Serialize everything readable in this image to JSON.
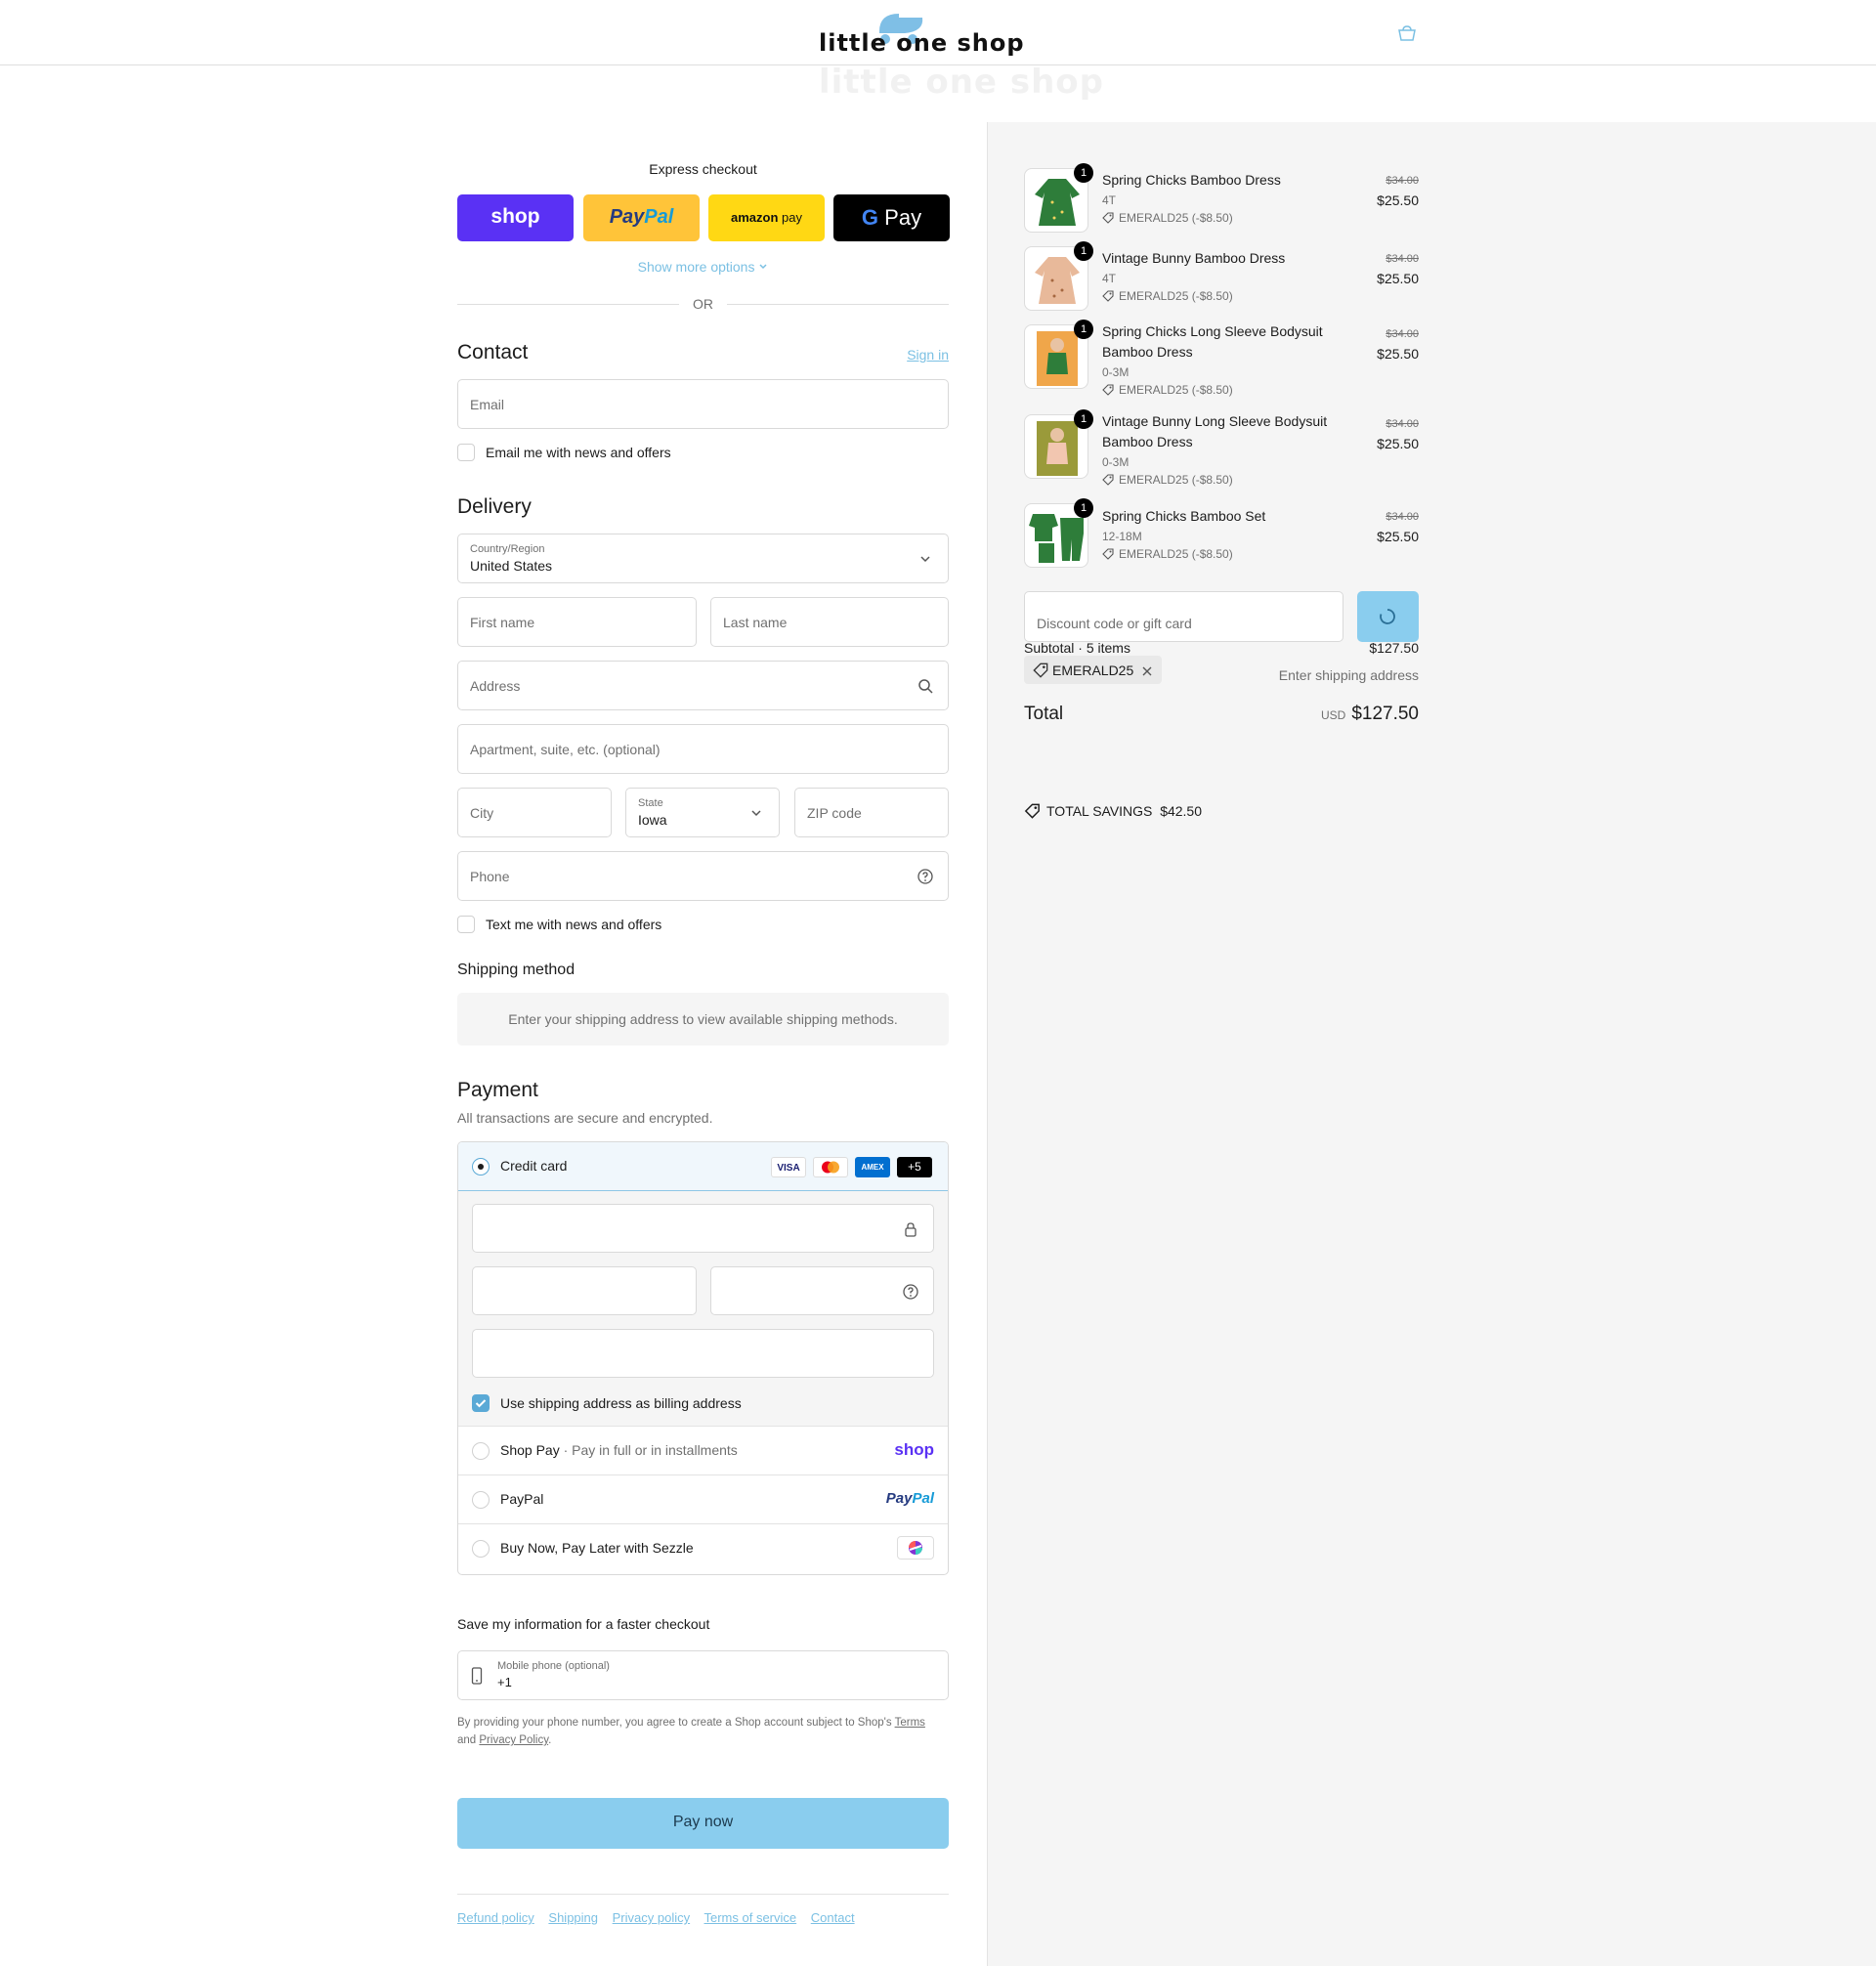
{
  "header": {
    "logo_text": "little one shop",
    "logo_ghost_text": "little one shop",
    "bag_icon": "shopping-bag-icon"
  },
  "express": {
    "title": "Express checkout",
    "shop_label": "shop",
    "paypal_label_a": "Pay",
    "paypal_label_b": "Pal",
    "amazon_label_a": "amazon",
    "amazon_label_b": "pay",
    "gpay_label_a": "G",
    "gpay_label_b": "Pay",
    "more_options": "Show more options",
    "or": "OR"
  },
  "contact": {
    "title": "Contact",
    "sign_in": "Sign in",
    "email_placeholder": "Email",
    "newsletter_label": "Email me with news and offers"
  },
  "delivery": {
    "title": "Delivery",
    "country_label": "Country/Region",
    "country_value": "United States",
    "first_name": "First name",
    "last_name": "Last name",
    "address": "Address",
    "apartment": "Apartment, suite, etc. (optional)",
    "city": "City",
    "state_label": "State",
    "state_value": "Iowa",
    "zip": "ZIP code",
    "phone": "Phone",
    "sms_label": "Text me with news and offers"
  },
  "shipping": {
    "title": "Shipping method",
    "notice": "Enter your shipping address to view available shipping methods."
  },
  "payment": {
    "title": "Payment",
    "subtitle": "All transactions are secure and encrypted.",
    "credit_card": "Credit card",
    "badges": [
      "VISA",
      "",
      "AMEX",
      "+5"
    ],
    "billing_same": "Use shipping address as billing address",
    "shop_pay": "Shop Pay",
    "shop_pay_desc": "Pay in full or in installments",
    "shop_pay_logo": "shop",
    "paypal": "PayPal",
    "paypal_logo_a": "Pay",
    "paypal_logo_b": "Pal",
    "sezzle": "Buy Now, Pay Later with Sezzle"
  },
  "save_info": {
    "title": "Save my information for a faster checkout",
    "mobile_label": "Mobile phone (optional)",
    "mobile_value": "+1",
    "legal_a": "By providing your phone number, you agree to create a Shop account subject to Shop's ",
    "legal_terms": "Terms",
    "legal_b": "and ",
    "legal_privacy": "Privacy Policy",
    "legal_c": "."
  },
  "pay_now": "Pay now",
  "footer_links": [
    "Refund policy",
    "Shipping",
    "Privacy policy",
    "Terms of service",
    "Contact"
  ],
  "summary": {
    "items": [
      {
        "qty": "1",
        "name": "Spring Chicks Bamboo Dress",
        "variant": "4T",
        "discount": "EMERALD25 (-$8.50)",
        "old_price": "$34.00",
        "price": "$25.50"
      },
      {
        "qty": "1",
        "name": "Vintage Bunny Bamboo Dress",
        "variant": "4T",
        "discount": "EMERALD25 (-$8.50)",
        "old_price": "$34.00",
        "price": "$25.50"
      },
      {
        "qty": "1",
        "name": "Spring Chicks Long Sleeve Bodysuit Bamboo Dress",
        "variant": "0-3M",
        "discount": "EMERALD25 (-$8.50)",
        "old_price": "$34.00",
        "price": "$25.50"
      },
      {
        "qty": "1",
        "name": "Vintage Bunny Long Sleeve Bodysuit Bamboo Dress",
        "variant": "0-3M",
        "discount": "EMERALD25 (-$8.50)",
        "old_price": "$34.00",
        "price": "$25.50"
      },
      {
        "qty": "1",
        "name": "Spring Chicks Bamboo Set",
        "variant": "12-18M",
        "discount": "EMERALD25 (-$8.50)",
        "old_price": "$34.00",
        "price": "$25.50"
      }
    ],
    "discount_placeholder": "Discount code or gift card",
    "subtotal_label": "Subtotal · 5 items",
    "subtotal_value": "$127.50",
    "code_chip": "EMERALD25",
    "shipping_note": "Enter shipping address",
    "total_label": "Total",
    "currency": "USD",
    "total_value": "$127.50",
    "savings_label": "TOTAL SAVINGS",
    "savings_value": "$42.50"
  },
  "colors": {
    "accent": "#7bc0e3",
    "pay_button": "#8acdee",
    "shop_purple": "#5a31f4",
    "paypal_yellow": "#ffc439",
    "amazon_yellow": "#ffd814"
  }
}
